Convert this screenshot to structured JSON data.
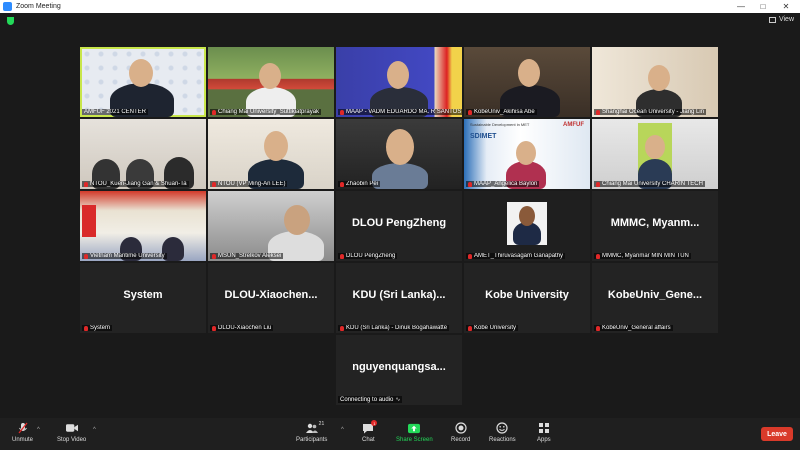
{
  "window": {
    "title": "Zoom Meeting"
  },
  "view_button": {
    "label": "View"
  },
  "tiles": [
    {
      "label": "AMFUF 2021 CENTER",
      "muted": false,
      "big": ""
    },
    {
      "label": "Chiang Mai University_Suttikiatprayak",
      "muted": true,
      "big": ""
    },
    {
      "label": "MAAP - VADM EDUARDO MA. R SANTOS",
      "muted": true,
      "big": ""
    },
    {
      "label": "KobeUniv_Akihisa Abe",
      "muted": true,
      "big": ""
    },
    {
      "label": "Shanghai Ocean University - Jiang Lin",
      "muted": true,
      "big": ""
    },
    {
      "label": "NTOU_Kuen-Jiang Gan & Shuan-Ta",
      "muted": true,
      "big": ""
    },
    {
      "label": "NTOU (VP Ming-An LEE)",
      "muted": true,
      "big": ""
    },
    {
      "label": "Zhaobin Pei",
      "muted": true,
      "big": ""
    },
    {
      "label": "MAAP_Angelica Baylon",
      "muted": true,
      "big": ""
    },
    {
      "label": "Chiang Mai University CHARIN TECH",
      "muted": true,
      "big": ""
    },
    {
      "label": "Vietnam Maritime University",
      "muted": true,
      "big": ""
    },
    {
      "label": "MSUN_Strelkov Aleksei",
      "muted": true,
      "big": ""
    },
    {
      "label": "DLOU PengZheng",
      "muted": true,
      "big": "DLOU PengZheng"
    },
    {
      "label": "AMET_Thiruvasagam Ganapathy",
      "muted": true,
      "big": ""
    },
    {
      "label": "MMMC, Myanmar MIN MIN TUN",
      "muted": true,
      "big": "MMMC,  Myanm..."
    },
    {
      "label": "System",
      "muted": true,
      "big": "System"
    },
    {
      "label": "DLOU-Xiaochen Liu",
      "muted": true,
      "big": "DLOU-Xiaochen..."
    },
    {
      "label": "KDU (Sri Lanka) - Dinuk Bogahawatte",
      "muted": true,
      "big": "KDU  (Sri  Lanka)..."
    },
    {
      "label": "Kobe University",
      "muted": true,
      "big": "Kobe University"
    },
    {
      "label": "KobeUniv_General affairs",
      "muted": true,
      "big": "KobeUniv_Gene..."
    },
    {
      "label": "Connecting to audio",
      "muted": false,
      "big": "nguyenquangsa..."
    }
  ],
  "slide": {
    "title": "Sustainable Development in MET",
    "brand": "AMFUF",
    "heading": "SDIMET"
  },
  "toolbar": {
    "unmute": "Unmute",
    "stop_video": "Stop Video",
    "participants": "Participants",
    "participants_count": "21",
    "chat": "Chat",
    "chat_badge": "1",
    "share_screen": "Share Screen",
    "record": "Record",
    "reactions": "Reactions",
    "apps": "Apps",
    "leave": "Leave"
  },
  "colors": {
    "accent_green": "#23d959",
    "leave_red": "#d93a2a",
    "active_border": "#c8e64a"
  }
}
